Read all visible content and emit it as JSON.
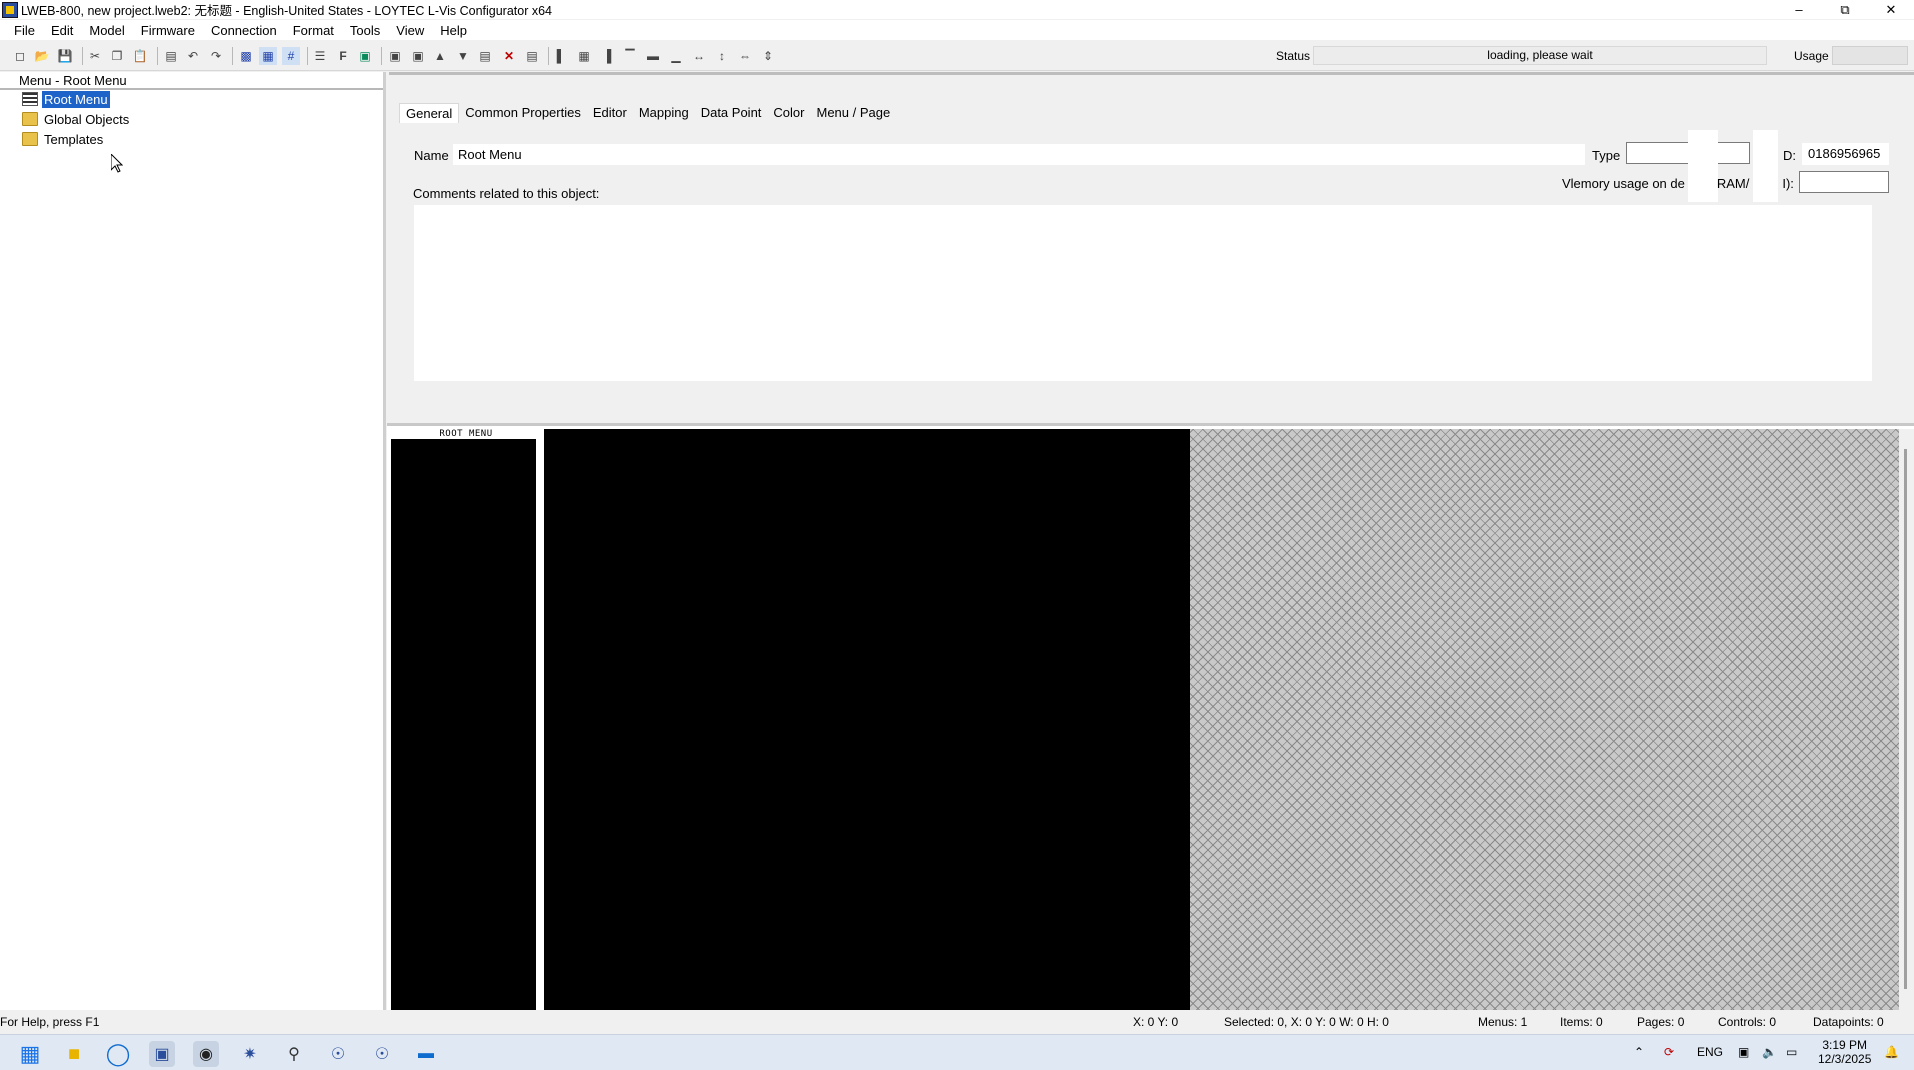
{
  "window": {
    "title": "LWEB-800, new project.lweb2: 无标题 - English-United States - LOYTEC L-Vis Configurator x64",
    "minimize_icon": "minimize-icon",
    "restore_icon": "restore-icon",
    "close_icon": "close-icon"
  },
  "menubar": [
    "File",
    "Edit",
    "Model",
    "Firmware",
    "Connection",
    "Format",
    "Tools",
    "View",
    "Help"
  ],
  "toolbar": {
    "icons": [
      "new-file-icon",
      "open-icon",
      "save-icon",
      "cut-icon",
      "copy-icon",
      "paste-icon",
      "paste-special-icon",
      "undo-icon",
      "redo-icon",
      "layer-icon",
      "grid-icon",
      "hash-grid-icon",
      "align-menu-icon",
      "font-icon",
      "image-icon",
      "move-back-icon",
      "move-front-icon",
      "bring-up-icon",
      "send-down-icon",
      "delete-icon",
      "align-bottom-icon",
      "align-left-icon",
      "align-center-icon",
      "align-right-icon",
      "align-top-icon",
      "align-middle-icon",
      "align-base-icon",
      "same-width-icon",
      "same-height-icon",
      "space-horizontal-icon",
      "space-vertical-icon"
    ],
    "status_label": "Status",
    "status_value": "loading, please wait",
    "usage_label": "Usage"
  },
  "left_panel": {
    "header": "Menu - Root Menu",
    "tree": [
      {
        "label": "Root Menu",
        "icon": "menu-icon",
        "selected": true
      },
      {
        "label": "Global Objects",
        "icon": "folder-icon",
        "selected": false
      },
      {
        "label": "Templates",
        "icon": "folder-icon",
        "selected": false
      }
    ]
  },
  "properties": {
    "tabs": [
      "General",
      "Common Properties",
      "Editor",
      "Mapping",
      "Data Point",
      "Color",
      "Menu / Page"
    ],
    "active_tab": "General",
    "name_label": "Name",
    "name_value": "Root Menu",
    "type_label": "Type",
    "id_label": "D:",
    "id_value": "0186956965",
    "memory_label_left": "Vlemory usage on de",
    "memory_label_mid": "RAM/",
    "memory_label_right": "I):",
    "comments_label": "Comments related to this object:"
  },
  "canvas": {
    "menu_panel_title": "ROOT MENU"
  },
  "statusbar": {
    "help": "For Help, press F1",
    "coords": "X: 0 Y: 0",
    "selected": "Selected: 0, X: 0 Y: 0 W: 0 H: 0",
    "menus": "Menus: 1",
    "items": "Items: 0",
    "pages": "Pages: 0",
    "controls": "Controls: 0",
    "datapoints": "Datapoints: 0"
  },
  "taskbar": {
    "apps": [
      "windows-start-icon",
      "file-explorer-icon",
      "edge-browser-icon",
      "lvis-app-icon",
      "lvis-configurator-icon",
      "network-tool-icon",
      "search-tool-icon",
      "globe-app-icon",
      "globe-app-2-icon",
      "terminal-icon"
    ],
    "tray_lang": "ENG",
    "time": "3:19 PM",
    "date": "12/3/2025"
  },
  "colors": {
    "selection": "#1e64c8",
    "canvas_bg": "#000000",
    "pattern_bg": "#c9c9c9"
  }
}
